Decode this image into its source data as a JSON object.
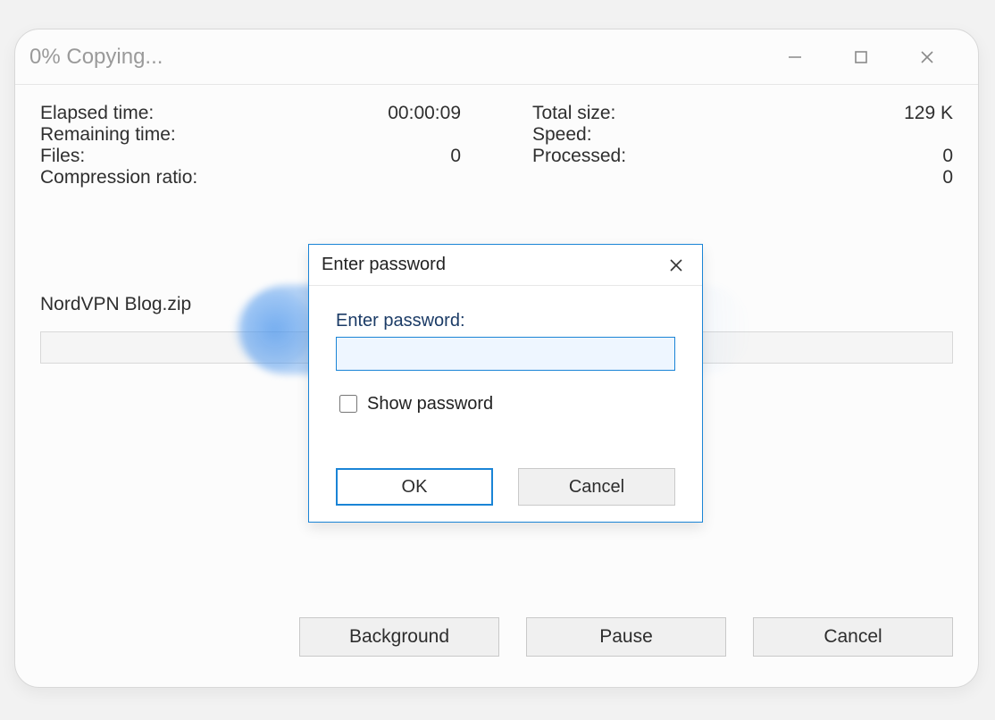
{
  "window": {
    "title": "0% Copying..."
  },
  "stats": {
    "left": [
      {
        "label": "Elapsed time:",
        "value": "00:00:09"
      },
      {
        "label": "Remaining time:",
        "value": ""
      },
      {
        "label": "Files:",
        "value": "0"
      },
      {
        "label": "Compression ratio:",
        "value": ""
      }
    ],
    "right": [
      {
        "label": "Total size:",
        "value": "129 K"
      },
      {
        "label": "Speed:",
        "value": ""
      },
      {
        "label": "Processed:",
        "value": "0"
      },
      {
        "label": "",
        "value": "0"
      }
    ]
  },
  "filename": "NordVPN Blog.zip",
  "buttons": {
    "background": "Background",
    "pause": "Pause",
    "cancel": "Cancel"
  },
  "dialog": {
    "title": "Enter password",
    "label": "Enter password:",
    "value": "",
    "placeholder": "",
    "show_password_label": "Show password",
    "ok": "OK",
    "cancel": "Cancel"
  }
}
